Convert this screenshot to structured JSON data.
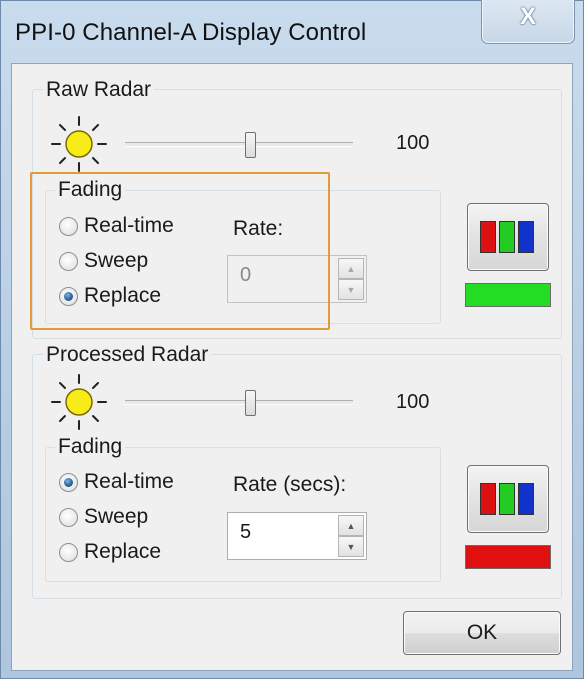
{
  "window": {
    "title": "PPI-0 Channel-A Display Control",
    "close_glyph": "X"
  },
  "raw_radar": {
    "group_label": "Raw Radar",
    "brightness_icon": "sun-icon",
    "brightness_value": "100",
    "brightness_level_fraction": 0.55,
    "fading": {
      "label": "Fading",
      "options": [
        "Real-time",
        "Sweep",
        "Replace"
      ],
      "selected": "Replace"
    },
    "rate": {
      "label": "Rate:",
      "value": "0",
      "enabled": false
    },
    "color_button_icon": "rgb-bars-icon",
    "color_swatch": "#22dd22",
    "highlighted": true,
    "highlight_color": "#e39a3b"
  },
  "processed_radar": {
    "group_label": "Processed Radar",
    "brightness_icon": "sun-icon",
    "brightness_value": "100",
    "brightness_level_fraction": 0.55,
    "fading": {
      "label": "Fading",
      "options": [
        "Real-time",
        "Sweep",
        "Replace"
      ],
      "selected": "Real-time"
    },
    "rate": {
      "label": "Rate (secs):",
      "value": "5",
      "enabled": true
    },
    "color_button_icon": "rgb-bars-icon",
    "color_swatch": "#e01010"
  },
  "colors": {
    "rgb_icon_red": "#dd1111",
    "rgb_icon_green": "#22cc22",
    "rgb_icon_blue": "#1133cc"
  },
  "buttons": {
    "ok_label": "OK"
  }
}
